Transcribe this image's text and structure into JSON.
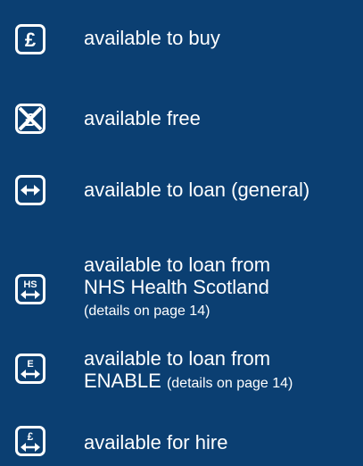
{
  "legend": {
    "items": [
      {
        "icon": "pound-sign-icon",
        "label": "available to buy"
      },
      {
        "icon": "crossed-out-pound-icon",
        "label": "available free"
      },
      {
        "icon": "two-way-arrow-icon",
        "label": "available to loan (general)"
      },
      {
        "icon": "hs-arrow-icon",
        "icon_text": "HS",
        "label_line1": "available to loan from",
        "label_line2": "NHS Health Scotland",
        "note": "(details on page 14)"
      },
      {
        "icon": "e-arrow-icon",
        "icon_text": "E",
        "label_line1": "available to loan from",
        "label_line2": "ENABLE",
        "note": "(details on page 14)"
      },
      {
        "icon": "pound-arrow-icon",
        "icon_text": "£",
        "label": "available for hire"
      }
    ]
  },
  "colors": {
    "background": "#0b3f72",
    "foreground": "#ffffff"
  }
}
